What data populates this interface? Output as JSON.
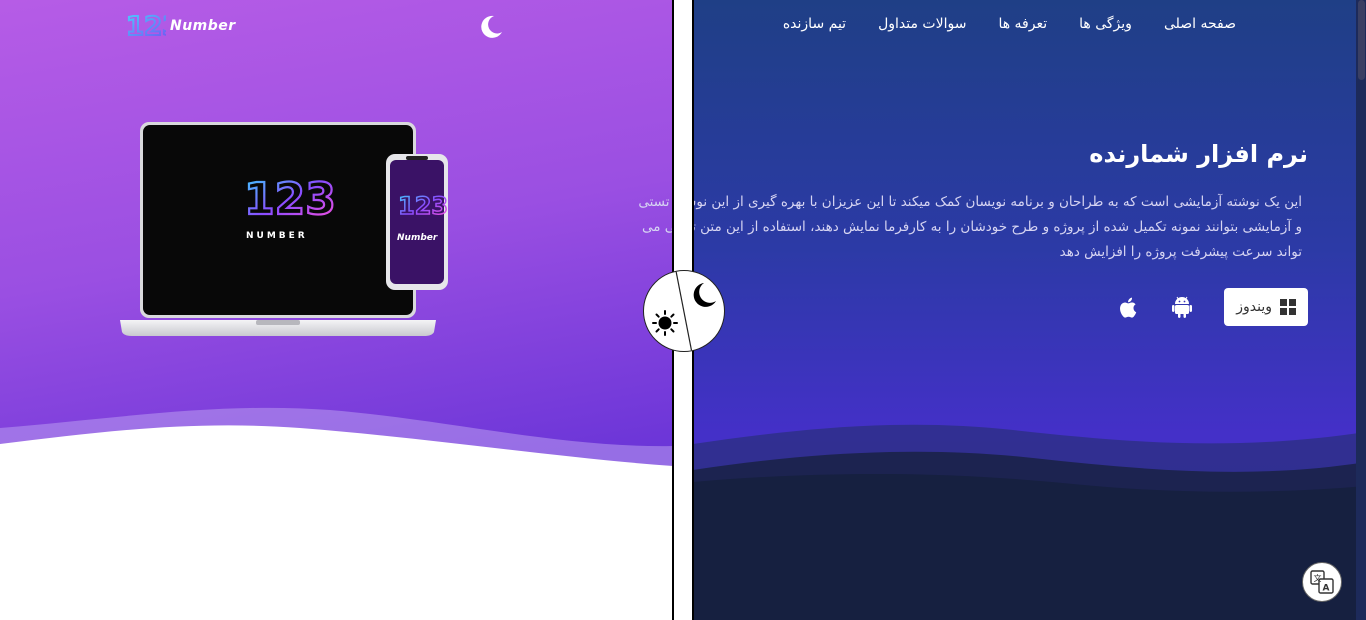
{
  "brand": {
    "logo_text": "Number",
    "logo_mark": "123"
  },
  "nav": {
    "items": [
      {
        "label": "صفحه اصلی"
      },
      {
        "label": "ویژگی ها"
      },
      {
        "label": "تعرفه ها"
      },
      {
        "label": "سوالات متداول"
      },
      {
        "label": "تیم سازنده"
      }
    ]
  },
  "hero": {
    "title": "نرم افزار شمارنده",
    "description": "این یک نوشته آزمایشی است که به طراحان و برنامه نویسان کمک میکند تا این عزیزان با بهره گیری از این نوشته تستی و آزمایشی بتوانند نمونه تکمیل شده از پروژه و طرح خودشان را به کارفرما نمایش دهند، استفاده از این متن تستی می تواند سرعت پیشرفت پروژه را افزایش دهد",
    "downloads": {
      "windows_label": "ویندوز",
      "icons": [
        "windows-icon",
        "android-icon",
        "apple-icon"
      ]
    }
  },
  "device_screens": {
    "laptop_text": "NUMBER",
    "phone_text": "Number"
  },
  "theme_toggle": {
    "icons": [
      "sun-icon",
      "moon-icon"
    ]
  },
  "colors": {
    "light_bg_start": "#b65ce6",
    "light_bg_end": "#5a2fd0",
    "dark_bg_start": "#1f3f86",
    "dark_bg_end": "#3c2fb8",
    "dark_footer": "#162040"
  }
}
